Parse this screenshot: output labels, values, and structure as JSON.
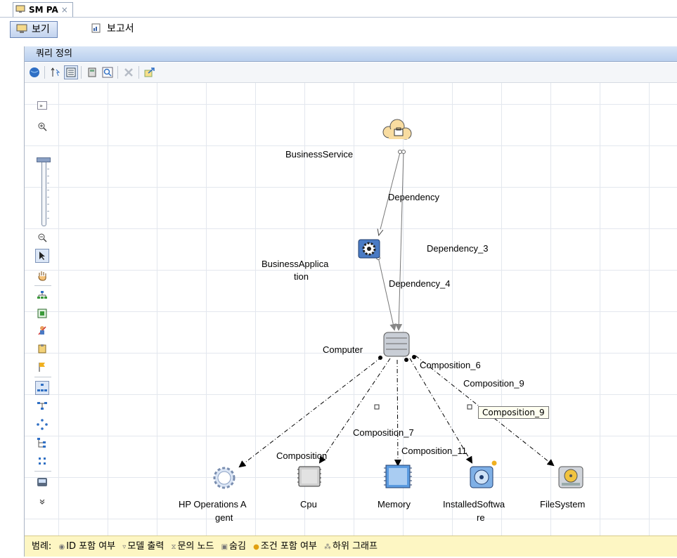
{
  "tab": {
    "title": "SM PA",
    "close": "×"
  },
  "views": {
    "view_label": "보기",
    "report_label": "보고서"
  },
  "panel": {
    "title": "쿼리 정의"
  },
  "nodes": {
    "business_service": "BusinessService",
    "business_application_line1": "BusinessApplica",
    "business_application_line2": "tion",
    "computer": "Computer",
    "hp_agent_line1": "HP Operations A",
    "hp_agent_line2": "gent",
    "cpu": "Cpu",
    "memory": "Memory",
    "installed_software_line1": "InstalledSoftwa",
    "installed_software_line2": "re",
    "filesystem": "FileSystem"
  },
  "edges": {
    "dependency": "Dependency",
    "dependency_3": "Dependency_3",
    "dependency_4": "Dependency_4",
    "composition": "Composition",
    "composition_6": "Composition_6",
    "composition_7": "Composition_7",
    "composition_9": "Composition_9",
    "composition_11": "Composition_11"
  },
  "tooltip": "Composition_9",
  "legend": {
    "title": "범례:",
    "items": [
      "ID 포함 여부",
      "모델 출력",
      "문의 노드",
      "숨김",
      "조건 포함 여부",
      "하위 그래프"
    ]
  },
  "colors": {
    "accent": "#3b64a8",
    "legend_bg": "#fdf6c3",
    "panel_title_bg": "#c9dbf3"
  }
}
